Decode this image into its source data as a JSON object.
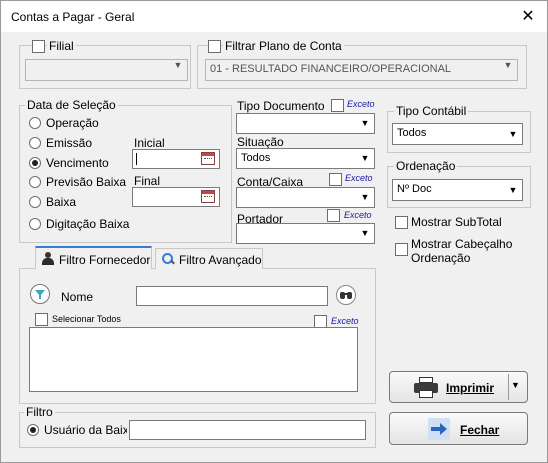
{
  "window": {
    "title": "Contas a Pagar - Geral",
    "close_symbol": "✕"
  },
  "filial": {
    "label": "Filial",
    "value": ""
  },
  "plano_conta": {
    "label": "Filtrar Plano de Conta",
    "value": "01  -  RESULTADO FINANCEIRO/OPERACIONAL"
  },
  "data_selecao": {
    "label": "Data de Seleção",
    "options": [
      "Operação",
      "Emissão",
      "Vencimento",
      "Previsão Baixa",
      "Baixa",
      "Digitação Baixa"
    ],
    "selected": "Vencimento",
    "inicial_label": "Inicial",
    "inicial_value": "",
    "final_label": "Final",
    "final_value": ""
  },
  "tipo_documento": {
    "label": "Tipo Documento",
    "exceto": "Exceto",
    "value": ""
  },
  "situacao": {
    "label": "Situação",
    "value": "Todos"
  },
  "conta_caixa": {
    "label": "Conta/Caixa",
    "exceto": "Exceto",
    "value": ""
  },
  "portador": {
    "label": "Portador",
    "exceto": "Exceto",
    "value": ""
  },
  "tipo_contabil": {
    "label": "Tipo Contábil",
    "value": "Todos"
  },
  "ordenacao": {
    "label": "Ordenação",
    "value": "Nº Doc"
  },
  "mostrar_subtotal": {
    "label": "Mostrar SubTotal"
  },
  "mostrar_cabecalho": {
    "label_line1": "Mostrar Cabeçalho",
    "label_line2": "Ordenação"
  },
  "tabs": [
    {
      "label": "Filtro Fornecedor",
      "icon": "user-icon"
    },
    {
      "label": "Filtro Avançado",
      "icon": "magnifier-icon"
    }
  ],
  "fornecedor": {
    "nome_label": "Nome",
    "nome_value": "",
    "selecionar_todos": "Selecionar Todos",
    "exceto": "Exceto"
  },
  "filtro": {
    "label": "Filtro",
    "usuario_label": "Usuário da Baixa",
    "usuario_value": ""
  },
  "buttons": {
    "imprimir": "Imprimir",
    "fechar": "Fechar"
  },
  "colors": {
    "accent": "#3a7bd5",
    "exceto_text": "#1a1aa8"
  }
}
